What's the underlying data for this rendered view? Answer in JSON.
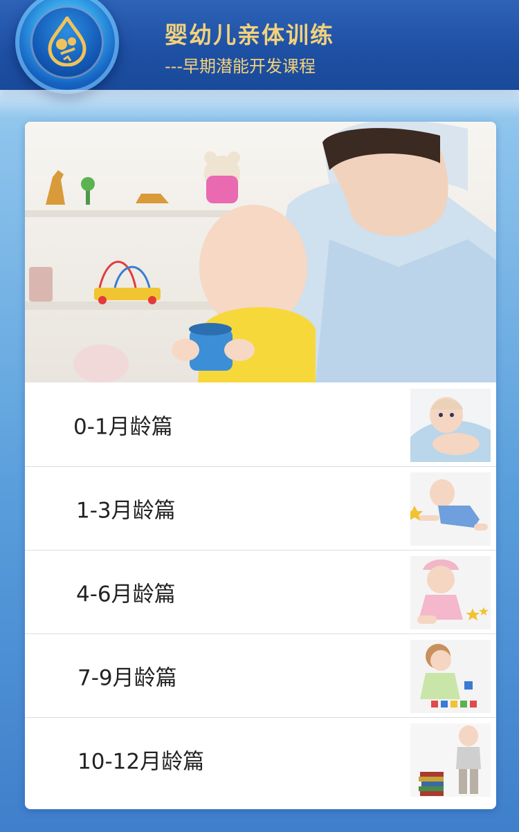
{
  "header": {
    "title": "婴幼儿亲体训练",
    "subtitle": "---早期潜能开发课程",
    "accent_gold": "#f3d27a",
    "bar_color": "#1d4fa3"
  },
  "hero": {
    "icon": "nurse-with-baby-photo"
  },
  "courses": [
    {
      "label": "0-1月龄篇",
      "thumb": "baby-lying-on-blanket-photo"
    },
    {
      "label": "1-3月龄篇",
      "thumb": "baby-crawling-photo"
    },
    {
      "label": "4-6月龄篇",
      "thumb": "baby-girl-sitting-photo"
    },
    {
      "label": "7-9月龄篇",
      "thumb": "baby-with-blocks-photo"
    },
    {
      "label": "10-12月龄篇",
      "thumb": "toddler-standing-with-books-photo"
    }
  ]
}
